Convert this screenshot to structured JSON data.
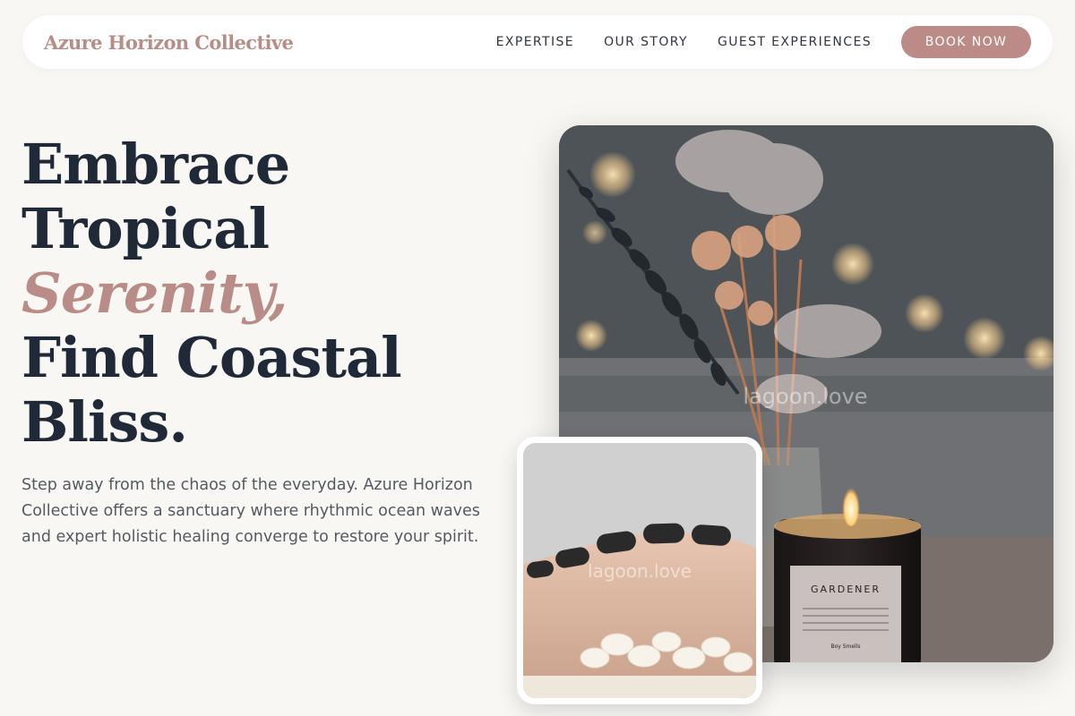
{
  "header": {
    "brand": "Azure Horizon Collective",
    "nav": [
      "EXPERTISE",
      "OUR STORY",
      "GUEST EXPERIENCES"
    ],
    "cta": "BOOK NOW"
  },
  "hero": {
    "headline_lines": [
      "Embrace",
      "Tropical",
      "Serenity,",
      "Find Coastal",
      "Bliss."
    ],
    "intro": "Step away from the chaos of the everyday. Azure Horizon Collective offers a sanctuary where rhythmic ocean waves and expert holistic healing converge to restore your spirit."
  },
  "images": {
    "main": {
      "watermark": "lagoon.love",
      "candle_label": "GARDENER",
      "candle_brand": "Boy Smells"
    },
    "inset": {
      "watermark": "lagoon.love"
    }
  },
  "colors": {
    "accent": "#b98c88",
    "button": "#bd8b87",
    "heading": "#1f2937",
    "background": "#f8f7f4"
  }
}
